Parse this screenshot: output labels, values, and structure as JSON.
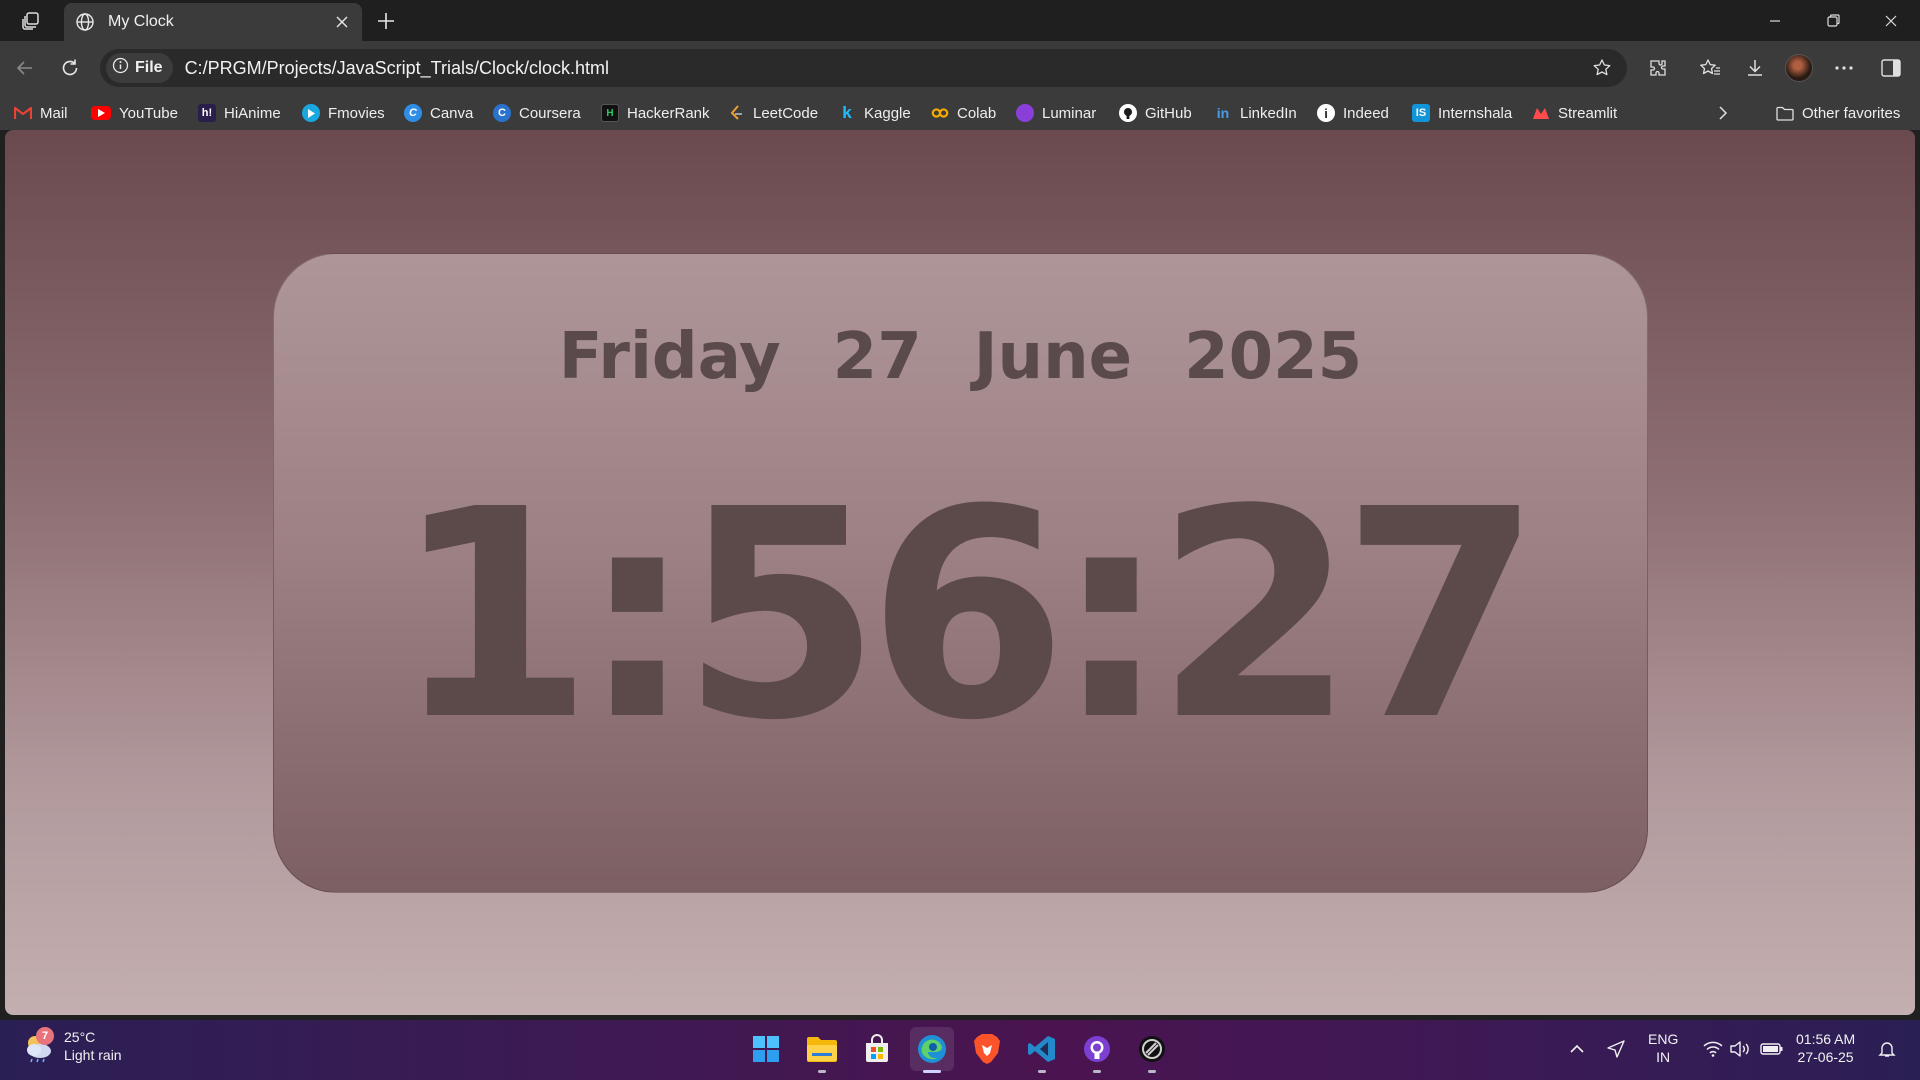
{
  "browser": {
    "tab": {
      "title": "My Clock"
    },
    "address": {
      "scheme_label": "File",
      "url": "C:/PRGM/Projects/JavaScript_Trials/Clock/clock.html"
    },
    "favorites": [
      {
        "label": "Mail",
        "icon": "gmail-icon",
        "color": "#ea4335"
      },
      {
        "label": "YouTube",
        "icon": "youtube-icon",
        "color": "#ff0000"
      },
      {
        "label": "HiAnime",
        "icon": "hianime-icon",
        "color": "#5a3fa8"
      },
      {
        "label": "Fmovies",
        "icon": "play-icon",
        "color": "#19a7e0"
      },
      {
        "label": "Canva",
        "icon": "canva-icon",
        "color": "#2e8de6"
      },
      {
        "label": "Coursera",
        "icon": "coursera-icon",
        "color": "#2a73cc"
      },
      {
        "label": "HackerRank",
        "icon": "hackerrank-icon",
        "color": "#111111"
      },
      {
        "label": "LeetCode",
        "icon": "leetcode-icon",
        "color": "#f0a030"
      },
      {
        "label": "Kaggle",
        "icon": "kaggle-icon",
        "color": "#20beff"
      },
      {
        "label": "Colab",
        "icon": "colab-icon",
        "color": "#f9ab00"
      },
      {
        "label": "Luminar",
        "icon": "luminar-icon",
        "color": "#8b3fd9"
      },
      {
        "label": "GitHub",
        "icon": "github-icon",
        "color": "#ffffff"
      },
      {
        "label": "LinkedIn",
        "icon": "linkedin-icon",
        "color": "#0a66c2"
      },
      {
        "label": "Indeed",
        "icon": "indeed-icon",
        "color": "#ffffff"
      },
      {
        "label": "Internshala",
        "icon": "internshala-icon",
        "color": "#1295d8"
      },
      {
        "label": "Streamlit",
        "icon": "streamlit-icon",
        "color": "#ff4b4b"
      }
    ],
    "other_favorites": "Other favorites"
  },
  "page": {
    "date": {
      "day": "Friday",
      "date": "27",
      "month": "June",
      "year": "2025"
    },
    "time": "1:56:27"
  },
  "taskbar": {
    "weather": {
      "temp": "25°C",
      "condition": "Light rain",
      "badge": "7"
    },
    "apps": [
      "start",
      "file-explorer",
      "microsoft-store",
      "edge",
      "brave",
      "vscode",
      "github-desktop",
      "linear-app"
    ],
    "language": {
      "line1": "ENG",
      "line2": "IN"
    },
    "clock": {
      "time": "01:56 AM",
      "date": "27-06-25"
    }
  }
}
